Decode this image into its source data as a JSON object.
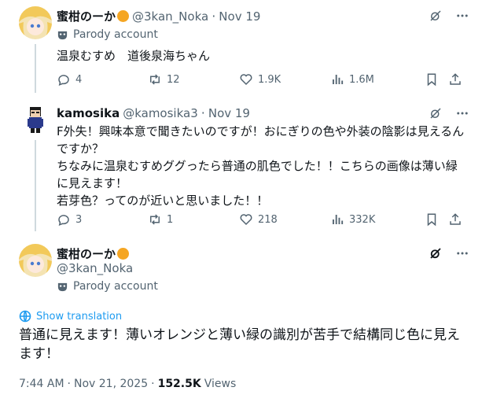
{
  "tweet1": {
    "name": "蜜柑のーか",
    "handle": "@3kan_Noka",
    "dot": "·",
    "date": "Nov 19",
    "parody": "Parody account",
    "text": "温泉むすめ　道後泉海ちゃん",
    "stats": {
      "replies": "4",
      "reposts": "12",
      "likes": "1.9K",
      "views": "1.6M"
    }
  },
  "tweet2": {
    "name": "kamosika",
    "handle": "@kamosika3",
    "dot": "·",
    "date": "Nov 19",
    "lines": [
      "F外失！興味本意で聞きたいのですが！おにぎりの色や外装の陰影は見えるん",
      "ですか？",
      "ちなみに温泉むすめググったら普通の肌色でした！！こちらの画像は薄い緑",
      "に見えます！",
      "若芽色？ってのが近いと思いました！！"
    ],
    "stats": {
      "replies": "3",
      "reposts": "1",
      "likes": "218",
      "views": "332K"
    }
  },
  "main": {
    "name": "蜜柑のーか",
    "handle": "@3kan_Noka",
    "parody": "Parody account",
    "translate": "Show translation",
    "lines": [
      "普通に見えます！薄いオレンジと薄い緑の識別が苦手で結構同じ色に見え",
      "ます！"
    ],
    "time": "7:44 AM",
    "dot": "·",
    "date": "Nov 21, 2025",
    "views_count": "152.5K",
    "views_label": "Views"
  },
  "colors": {
    "accent": "#1d9bf0",
    "muted": "#536471",
    "orange": "#f5a623"
  }
}
